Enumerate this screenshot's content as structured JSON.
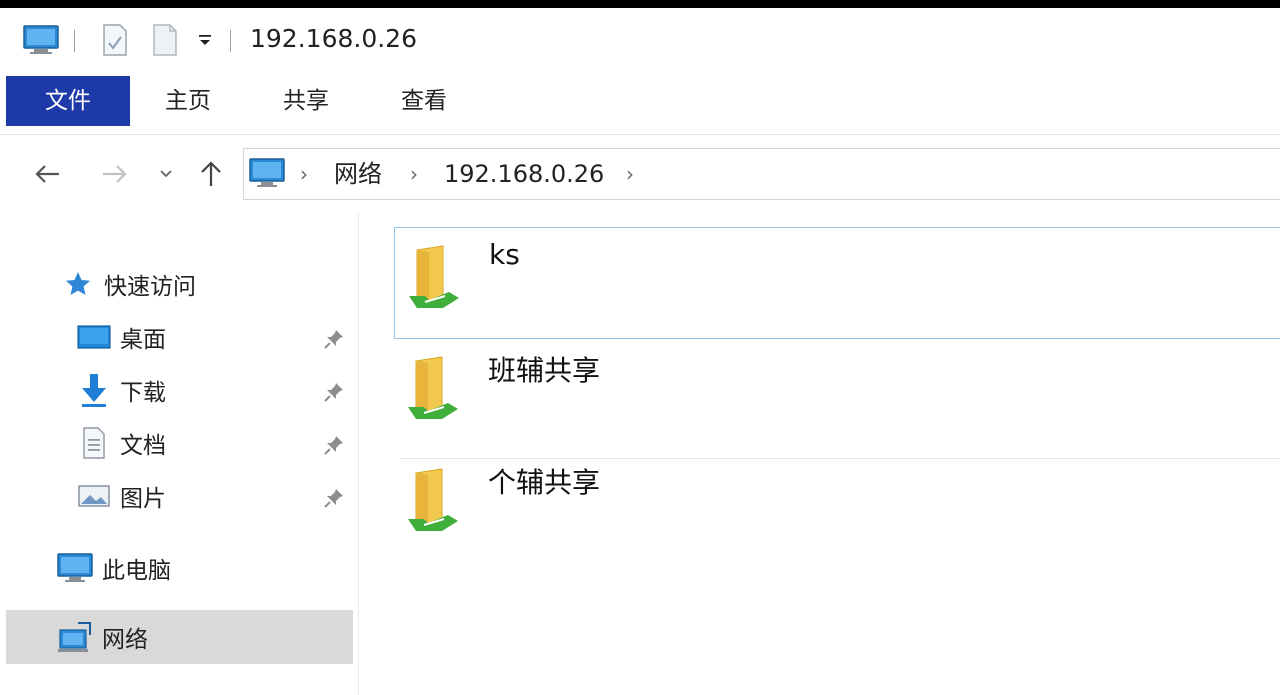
{
  "window": {
    "title": "192.168.0.26"
  },
  "ribbon": {
    "tabs": [
      {
        "label": "文件",
        "active": true
      },
      {
        "label": "主页",
        "active": false
      },
      {
        "label": "共享",
        "active": false
      },
      {
        "label": "查看",
        "active": false
      }
    ]
  },
  "address": {
    "crumbs": [
      "网络",
      "192.168.0.26"
    ]
  },
  "navpane": {
    "quick_access": "快速访问",
    "pinned": [
      {
        "label": "桌面",
        "icon": "desktop-icon"
      },
      {
        "label": "下载",
        "icon": "download-icon"
      },
      {
        "label": "文档",
        "icon": "document-icon"
      },
      {
        "label": "图片",
        "icon": "pictures-icon"
      }
    ],
    "this_pc": "此电脑",
    "network": "网络"
  },
  "shares": [
    {
      "name": "ks",
      "selected": true
    },
    {
      "name": "班辅共享",
      "selected": false
    },
    {
      "name": "个辅共享",
      "selected": false
    }
  ],
  "colors": {
    "ribbon_active": "#1e3aa8",
    "selection_border": "#8ec3ea",
    "nav_selected": "#d9d9d9",
    "folder_yellow": "#f2c94c",
    "share_green": "#3fae3a",
    "accent_blue": "#1f86d8"
  }
}
